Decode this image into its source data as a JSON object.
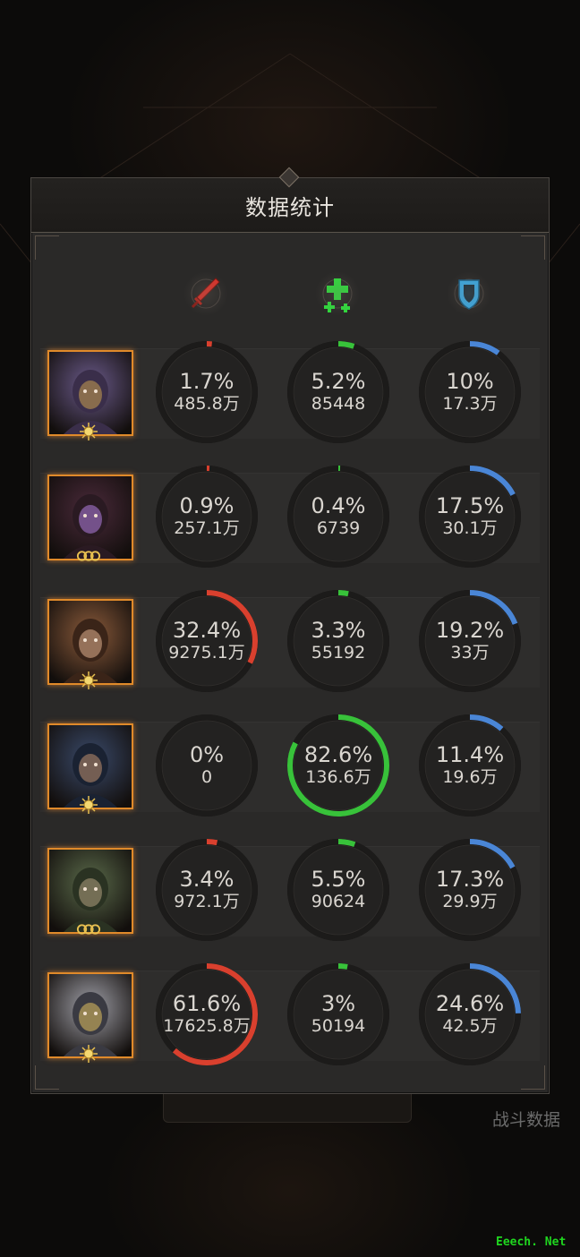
{
  "panel": {
    "title": "数据统计"
  },
  "background": {
    "stats_label": "战斗数据"
  },
  "watermark": "Eeech. Net",
  "columns": [
    {
      "icon": "sword-icon",
      "color": "#d8322a"
    },
    {
      "icon": "heal-plus-icon",
      "color": "#2fd93c"
    },
    {
      "icon": "shield-icon",
      "color": "#3aa7e0"
    }
  ],
  "colors": {
    "damage": "#d9402e",
    "heal": "#38c23a",
    "tank": "#4a86d6"
  },
  "heroes": [
    {
      "name": "hero-1",
      "badge": "sun",
      "stats": [
        {
          "pct_label": "1.7%",
          "value": "485.8万",
          "fraction": 0.017
        },
        {
          "pct_label": "5.2%",
          "value": "85448",
          "fraction": 0.052
        },
        {
          "pct_label": "10%",
          "value": "17.3万",
          "fraction": 0.1
        }
      ]
    },
    {
      "name": "hero-2",
      "badge": "rings",
      "stats": [
        {
          "pct_label": "0.9%",
          "value": "257.1万",
          "fraction": 0.009
        },
        {
          "pct_label": "0.4%",
          "value": "6739",
          "fraction": 0.004
        },
        {
          "pct_label": "17.5%",
          "value": "30.1万",
          "fraction": 0.175
        }
      ]
    },
    {
      "name": "hero-3",
      "badge": "sun",
      "stats": [
        {
          "pct_label": "32.4%",
          "value": "9275.1万",
          "fraction": 0.324
        },
        {
          "pct_label": "3.3%",
          "value": "55192",
          "fraction": 0.033
        },
        {
          "pct_label": "19.2%",
          "value": "33万",
          "fraction": 0.192
        }
      ]
    },
    {
      "name": "hero-4",
      "badge": "sun",
      "stats": [
        {
          "pct_label": "0%",
          "value": "0",
          "fraction": 0
        },
        {
          "pct_label": "82.6%",
          "value": "136.6万",
          "fraction": 0.826
        },
        {
          "pct_label": "11.4%",
          "value": "19.6万",
          "fraction": 0.114
        }
      ]
    },
    {
      "name": "hero-5",
      "badge": "rings",
      "stats": [
        {
          "pct_label": "3.4%",
          "value": "972.1万",
          "fraction": 0.034
        },
        {
          "pct_label": "5.5%",
          "value": "90624",
          "fraction": 0.055
        },
        {
          "pct_label": "17.3%",
          "value": "29.9万",
          "fraction": 0.173
        }
      ]
    },
    {
      "name": "hero-6",
      "badge": "sun",
      "stats": [
        {
          "pct_label": "61.6%",
          "value": "17625.8万",
          "fraction": 0.616
        },
        {
          "pct_label": "3%",
          "value": "50194",
          "fraction": 0.03
        },
        {
          "pct_label": "24.6%",
          "value": "42.5万",
          "fraction": 0.246
        }
      ]
    }
  ]
}
